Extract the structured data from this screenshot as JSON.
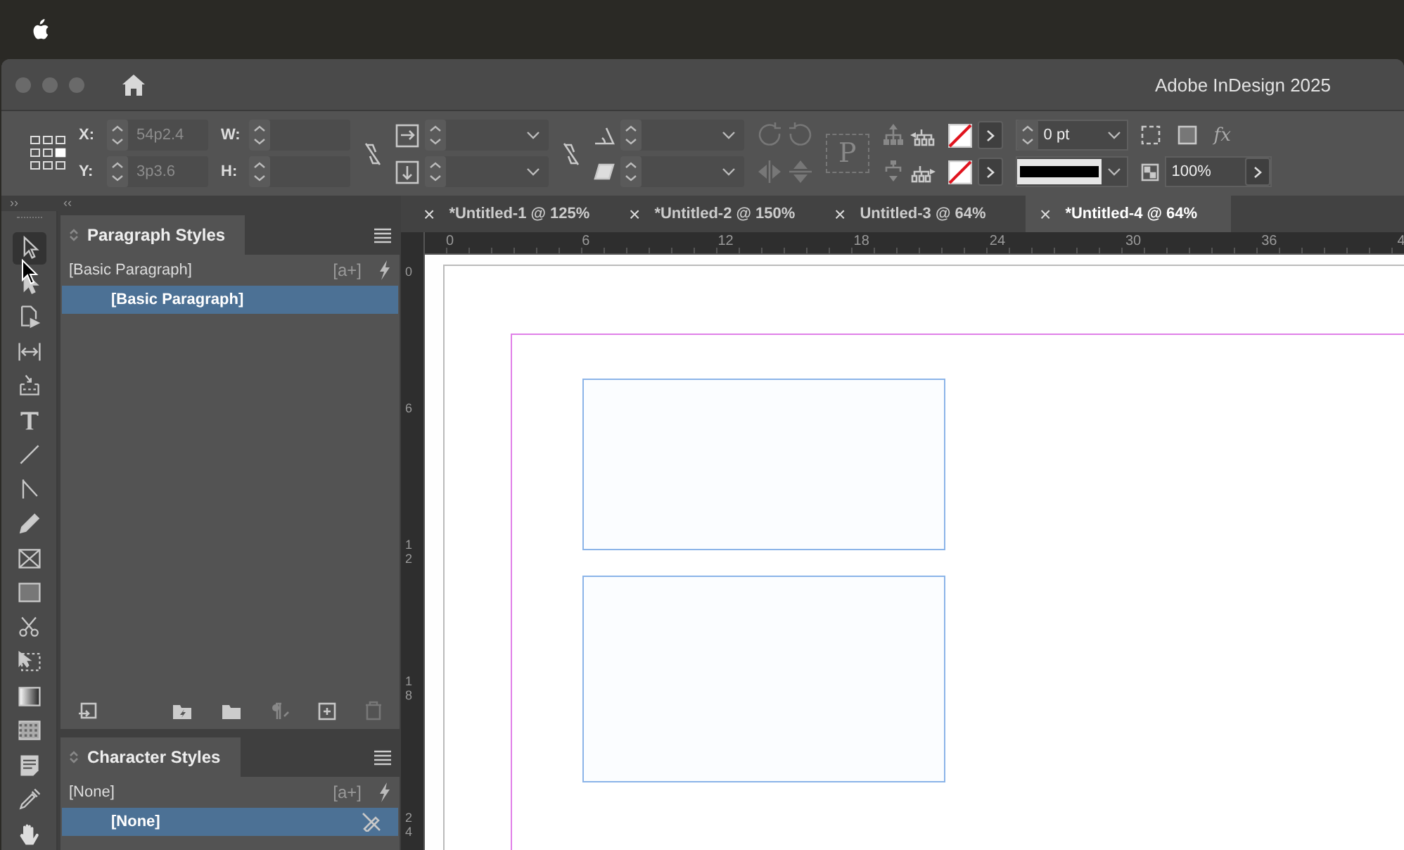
{
  "window": {
    "title": "Adobe InDesign 2025"
  },
  "control_panel": {
    "x_label": "X:",
    "x_value": "54p2.4",
    "y_label": "Y:",
    "y_value": "3p3.6",
    "w_label": "W:",
    "h_label": "H:",
    "content_glyph": "P",
    "stroke_weight": "0 pt",
    "effects_label": "fx",
    "opacity": "100%"
  },
  "panel_strip": {
    "expand": "››",
    "collapse": "‹‹"
  },
  "tools": [
    {
      "kind": "selection",
      "selected": true
    },
    {
      "kind": "direct",
      "selected": false
    },
    {
      "kind": "page",
      "selected": false
    },
    {
      "kind": "gap",
      "selected": false
    },
    {
      "kind": "collector",
      "selected": false
    },
    {
      "kind": "type",
      "selected": false
    },
    {
      "kind": "line",
      "selected": false
    },
    {
      "kind": "pen",
      "selected": false
    },
    {
      "kind": "pencil",
      "selected": false
    },
    {
      "kind": "frame",
      "selected": false
    },
    {
      "kind": "rectangle",
      "selected": false
    },
    {
      "kind": "scissors",
      "selected": false
    },
    {
      "kind": "transform",
      "selected": false
    },
    {
      "kind": "gradient",
      "selected": false
    },
    {
      "kind": "feather",
      "selected": false
    },
    {
      "kind": "note",
      "selected": false
    },
    {
      "kind": "eyedropper",
      "selected": false
    },
    {
      "kind": "hand",
      "selected": false
    }
  ],
  "paragraph_styles": {
    "title": "Paragraph Styles",
    "current": "[Basic Paragraph]",
    "new_style_tag": "[a+]",
    "items": [
      {
        "label": "[Basic Paragraph]",
        "selected": true
      }
    ]
  },
  "character_styles": {
    "title": "Character Styles",
    "current": "[None]",
    "new_style_tag": "[a+]",
    "items": [
      {
        "label": "[None]",
        "selected": true
      }
    ]
  },
  "document_tabs": [
    {
      "label": "*Untitled-1 @ 125%",
      "close": "×",
      "selected": false
    },
    {
      "label": "*Untitled-2 @ 150%",
      "close": "×",
      "selected": false
    },
    {
      "label": "Untitled-3 @ 64%",
      "close": "×",
      "selected": false
    },
    {
      "label": "*Untitled-4 @ 64%",
      "close": "×",
      "selected": true
    }
  ],
  "rulers": {
    "horizontal": [
      "0",
      "6",
      "12",
      "18",
      "24",
      "30",
      "36",
      "4"
    ],
    "vertical": [
      "0",
      "6",
      "12",
      "18",
      "24"
    ]
  }
}
